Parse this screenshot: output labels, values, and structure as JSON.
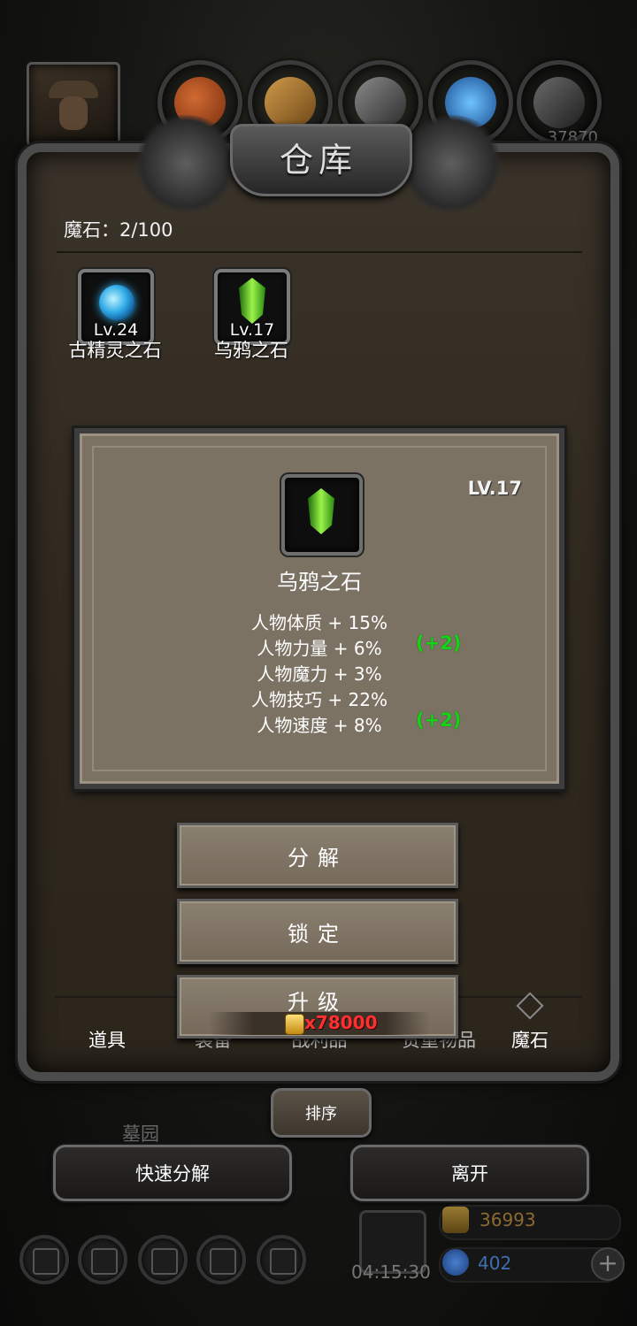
{
  "top_bar": {
    "resource_value": "37870",
    "orb_icons": [
      "meat-icon",
      "wood-icon",
      "iron-icon",
      "crystal-icon",
      "steel-icon"
    ]
  },
  "panel": {
    "title": "仓库",
    "stone_count": "魔石：2/100"
  },
  "inventory": [
    {
      "level": "Lv.24",
      "name": "古精灵之石",
      "icon": "blue-gem-icon"
    },
    {
      "level": "Lv.17",
      "name": "乌鸦之石",
      "icon": "green-crystal-icon"
    }
  ],
  "detail": {
    "level": "LV.17",
    "name": "乌鸦之石",
    "stats": [
      {
        "text": "人物体质 + 15%",
        "bonus": ""
      },
      {
        "text": "人物力量 + 6%",
        "bonus": "(+2)"
      },
      {
        "text": "人物魔力 + 3%",
        "bonus": ""
      },
      {
        "text": "人物技巧 + 22%",
        "bonus": ""
      },
      {
        "text": "人物速度 + 8%",
        "bonus": "(+2)"
      }
    ]
  },
  "actions": {
    "decompose": "分解",
    "lock": "锁定",
    "upgrade": "升级",
    "upgrade_cost": "x78000"
  },
  "tabs": [
    "道具",
    "装备",
    "战利品",
    "贵重物品",
    "魔石"
  ],
  "active_tab": "魔石",
  "sort_label": "排序",
  "area_label": "墓园",
  "quick_decompose": "快速分解",
  "leave": "离开",
  "hud": {
    "timer": "04:15:30",
    "gold": "36993",
    "gems": "402",
    "plus": "+"
  }
}
